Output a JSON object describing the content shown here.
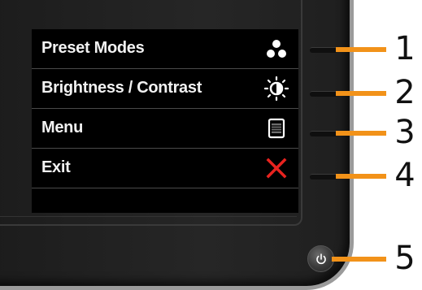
{
  "osd": {
    "items": [
      {
        "label": "Preset Modes",
        "icon": "preset-modes-icon"
      },
      {
        "label": "Brightness / Contrast",
        "icon": "brightness-contrast-icon"
      },
      {
        "label": "Menu",
        "icon": "menu-icon"
      },
      {
        "label": "Exit",
        "icon": "close-icon"
      }
    ]
  },
  "buttons": {
    "callouts": [
      "1",
      "2",
      "3",
      "4",
      "5"
    ]
  },
  "colors": {
    "callout": "#f29219",
    "exit_icon": "#e8231f",
    "osd_background": "#000000",
    "bezel": "#222222"
  }
}
